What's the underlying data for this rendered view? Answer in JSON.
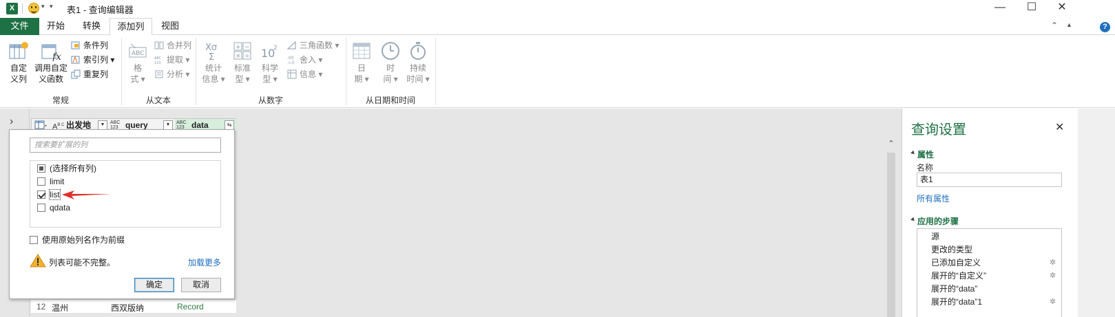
{
  "titlebar": {
    "app_icon": "X",
    "title": "表1 - 查询编辑器",
    "minimize": "—",
    "maximize": "☐",
    "close": "✕"
  },
  "tabs": {
    "file": "文件",
    "items": [
      "开始",
      "转换",
      "添加列",
      "视图"
    ],
    "active": "添加列"
  },
  "ribbon": {
    "groups": {
      "general": {
        "label": "常规",
        "custom_column": "自定\n义列",
        "custom_column_l1": "自定",
        "custom_column_l2": "义列",
        "invoke_function_l1": "调用自定",
        "invoke_function_l2": "义函数",
        "conditional_column": "条件列",
        "index_column": "索引列",
        "duplicate_column": "重复列"
      },
      "from_text": {
        "label": "从文本",
        "format_l1": "格",
        "format_l2": "式",
        "merge_columns": "合并列",
        "extract": "提取",
        "parse": "分析"
      },
      "from_number": {
        "label": "从数字",
        "statistics_l1": "统计",
        "statistics_l2": "信息",
        "standard_l1": "标准",
        "standard_l2": "型",
        "scientific_l1": "科学",
        "scientific_l2": "型",
        "trigonometry": "三角函数",
        "rounding": "舍入",
        "information": "信息"
      },
      "from_datetime": {
        "label": "从日期和时间",
        "date_l1": "日",
        "date_l2": "期",
        "time_l1": "时",
        "time_l2": "间",
        "duration_l1": "持续",
        "duration_l2": "时间"
      }
    }
  },
  "grid": {
    "columns": [
      {
        "name": "出发地",
        "type": "ABC"
      },
      {
        "name": "query",
        "type": "ABC\n123"
      },
      {
        "name": "data",
        "type": "ABC\n123"
      }
    ],
    "type_abc": "A",
    "type_abc_sub": "B C",
    "type_any_l1": "ABC",
    "type_any_l2": "123",
    "last_row": {
      "index": "12",
      "origin": "温州",
      "query": "西双版纳",
      "data": "Record"
    }
  },
  "expand_popup": {
    "search_placeholder": "搜索要扩展的列",
    "items": [
      {
        "label": "(选择所有列)",
        "state": "indeterminate"
      },
      {
        "label": "limit",
        "state": "unchecked"
      },
      {
        "label": "list",
        "state": "checked"
      },
      {
        "label": "qdata",
        "state": "unchecked"
      }
    ],
    "prefix_option": "使用原始列名作为前缀",
    "warning": "列表可能不完整。",
    "load_more": "加载更多",
    "ok": "确定",
    "cancel": "取消"
  },
  "settings": {
    "title": "查询设置",
    "close": "✕",
    "properties_header": "属性",
    "name_label": "名称",
    "name_value": "表1",
    "all_properties": "所有属性",
    "steps_header": "应用的步骤",
    "steps": [
      {
        "label": "源",
        "gear": false
      },
      {
        "label": "更改的类型",
        "gear": false
      },
      {
        "label": "已添加自定义",
        "gear": true
      },
      {
        "label": "展开的“自定义”",
        "gear": true
      },
      {
        "label": "展开的“data”",
        "gear": false
      },
      {
        "label": "展开的“data”1",
        "gear": true
      }
    ]
  },
  "colors": {
    "excel_green": "#1e7145",
    "link_blue": "#1f6fbf",
    "annotation_red": "#e0302b"
  }
}
